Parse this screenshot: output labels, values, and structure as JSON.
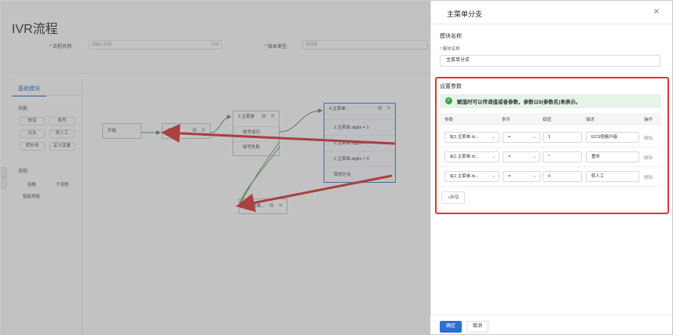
{
  "page": {
    "title": "IVR流程",
    "form": {
      "flow_name_label": "* 流程名称:",
      "flow_name_placeholder": "请输入名称",
      "flow_name_counter": "0/30",
      "version_type_label": "* 版本类型:",
      "version_type_placeholder": "请选择"
    }
  },
  "palette": {
    "tab_label": "基础模块",
    "function_label": "功能",
    "function_items": [
      "放音",
      "收号",
      "分支",
      "转人工",
      "转外线",
      "定义变量"
    ],
    "flow_label": "流程",
    "flow_items": [
      "函数",
      "子流程",
      "智能导航"
    ]
  },
  "canvas": {
    "start_node": "开始",
    "playback_node": "放音播",
    "menu_node": {
      "title": "2.主菜单",
      "ports": [
        "收号成功",
        "收号失败"
      ]
    },
    "branch_node": {
      "title": "4.主菜单...",
      "ports": [
        "2.主菜单.digits = 1",
        "2.主菜单.digits = *",
        "2.主菜单.digits = 0",
        "其他分支"
      ]
    },
    "submenu_node": "3.主菜单..."
  },
  "drawer": {
    "title": "主菜单分支",
    "close_icon": "close-icon",
    "module_section": "模块名称",
    "module_field_label": "模块名称",
    "module_field_value": "主菜单分支",
    "params_section": "设置参数",
    "alert_text": "赋值时可以传递值或者参数，参数以$(参数名)来表示。",
    "table_headers": {
      "param": "参数",
      "condition": "条件",
      "value": "赋值",
      "desc": "描述",
      "action": "操作"
    },
    "rows": [
      {
        "param": "$(2.主菜单.di...",
        "condition": "=",
        "value": "1",
        "desc": "ECS规格升级",
        "action": "删除"
      },
      {
        "param": "$(2.主菜单.di...",
        "condition": "=",
        "value": "*",
        "desc": "重听",
        "action": "删除"
      },
      {
        "param": "$(2.主菜单.di...",
        "condition": "=",
        "value": "0",
        "desc": "转人工",
        "action": "删除"
      }
    ],
    "add_label": "+新增",
    "ok_label": "确定",
    "cancel_label": "取消"
  },
  "colors": {
    "primary": "#2d6fd6",
    "highlight_red": "#d9383a",
    "success": "#3aa843"
  }
}
